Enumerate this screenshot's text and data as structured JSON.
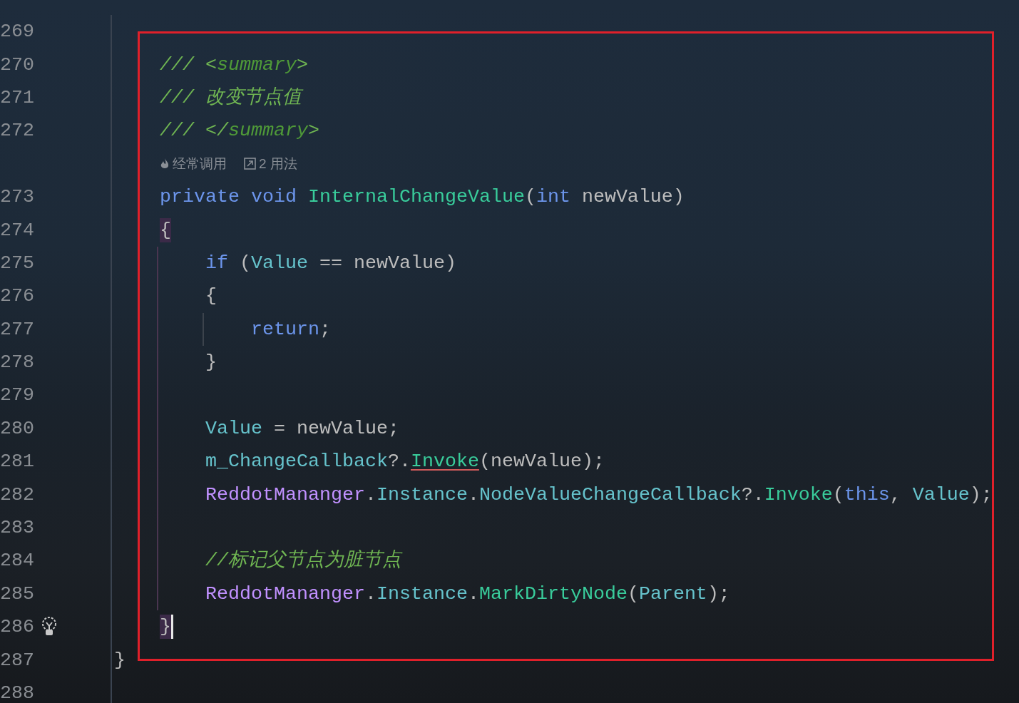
{
  "lines": [
    {
      "children": [
        {
          "kind": "code",
          "number": "269"
        },
        {
          "kind": "code",
          "number": "270",
          "tokens": [
            {
              "kind": "comment",
              "text": "/// <"
            },
            {
              "kind": "doc-tag",
              "text": "summary"
            },
            {
              "kind": "comment",
              "text": ">"
            }
          ]
        },
        {
          "kind": "code",
          "number": "271",
          "tokens": [
            {
              "kind": "comment",
              "text": "/// 改变节点值"
            }
          ]
        },
        {
          "kind": "code",
          "number": "272",
          "tokens": [
            {
              "kind": "comment",
              "text": "/// </"
            },
            {
              "kind": "doc-tag",
              "text": "summary"
            },
            {
              "kind": "comment",
              "text": ">"
            }
          ]
        },
        {
          "kind": "hints",
          "hints": [
            {
              "kind": "frequency",
              "text": "经常调用"
            },
            {
              "kind": "usages",
              "text": "2 用法"
            }
          ]
        },
        {
          "kind": "code",
          "number": "273",
          "tokens": [
            {
              "kind": "keyword",
              "text": "private void "
            },
            {
              "kind": "method",
              "text": "InternalChangeValue"
            },
            {
              "kind": "plain",
              "text": "("
            },
            {
              "kind": "keyword",
              "text": "int"
            },
            {
              "kind": "plain",
              "text": " newValue)"
            }
          ]
        },
        {
          "kind": "code",
          "number": "274",
          "tokens": [
            {
              "kind": "brace-match",
              "text": "{"
            }
          ]
        },
        {
          "children": [
            {
              "kind": "code",
              "number": "275",
              "tokens": [
                {
                  "kind": "keyword",
                  "text": "if"
                },
                {
                  "kind": "plain",
                  "text": " ("
                },
                {
                  "kind": "property",
                  "text": "Value"
                },
                {
                  "kind": "plain",
                  "text": " == newValue)"
                }
              ]
            },
            {
              "kind": "code",
              "number": "276",
              "tokens": [
                {
                  "kind": "plain",
                  "text": "{"
                }
              ]
            },
            {
              "children": [
                {
                  "kind": "code",
                  "number": "277",
                  "tokens": [
                    {
                      "kind": "keyword",
                      "text": "return"
                    },
                    {
                      "kind": "plain",
                      "text": ";"
                    }
                  ]
                }
              ]
            },
            {
              "kind": "code",
              "number": "278",
              "tokens": [
                {
                  "kind": "plain",
                  "text": "}"
                }
              ]
            },
            {
              "kind": "code",
              "number": "279"
            },
            {
              "kind": "code",
              "number": "280",
              "tokens": [
                {
                  "kind": "property",
                  "text": "Value"
                },
                {
                  "kind": "plain",
                  "text": " = newValue;"
                }
              ]
            },
            {
              "kind": "code",
              "number": "281",
              "tokens": [
                {
                  "kind": "property",
                  "text": "m_ChangeCallback"
                },
                {
                  "kind": "plain",
                  "text": "?."
                },
                {
                  "kind": "method-warning",
                  "text": "Invoke"
                },
                {
                  "kind": "plain",
                  "text": "(newValue);"
                }
              ]
            },
            {
              "kind": "code",
              "number": "282",
              "tokens": [
                {
                  "kind": "class",
                  "text": "ReddotMananger"
                },
                {
                  "kind": "plain",
                  "text": "."
                },
                {
                  "kind": "property",
                  "text": "Instance"
                },
                {
                  "kind": "plain",
                  "text": "."
                },
                {
                  "kind": "property",
                  "text": "NodeValueChangeCallback"
                },
                {
                  "kind": "plain",
                  "text": "?."
                },
                {
                  "kind": "method",
                  "text": "Invoke"
                },
                {
                  "kind": "plain",
                  "text": "("
                },
                {
                  "kind": "keyword",
                  "text": "this"
                },
                {
                  "kind": "plain",
                  "text": ", "
                },
                {
                  "kind": "property",
                  "text": "Value"
                },
                {
                  "kind": "plain",
                  "text": ");"
                }
              ]
            },
            {
              "kind": "code",
              "number": "283"
            },
            {
              "kind": "code",
              "number": "284",
              "tokens": [
                {
                  "kind": "comment",
                  "text": "//标记父节点为脏节点"
                }
              ]
            },
            {
              "kind": "code",
              "number": "285",
              "tokens": [
                {
                  "kind": "class",
                  "text": "ReddotMananger"
                },
                {
                  "kind": "plain",
                  "text": "."
                },
                {
                  "kind": "property",
                  "text": "Instance"
                },
                {
                  "kind": "plain",
                  "text": "."
                },
                {
                  "kind": "method",
                  "text": "MarkDirtyNode"
                },
                {
                  "kind": "plain",
                  "text": "("
                },
                {
                  "kind": "property",
                  "text": "Parent"
                },
                {
                  "kind": "plain",
                  "text": ");"
                }
              ]
            }
          ]
        },
        {
          "kind": "code-with-bulb",
          "number": "286",
          "tokens": [
            {
              "kind": "brace-match-caret",
              "text": "}"
            }
          ]
        }
      ]
    },
    {
      "kind": "code",
      "number": "287",
      "tokens": [
        {
          "kind": "plain",
          "text": "}"
        }
      ]
    },
    {
      "kind": "code",
      "number": "288"
    }
  ]
}
